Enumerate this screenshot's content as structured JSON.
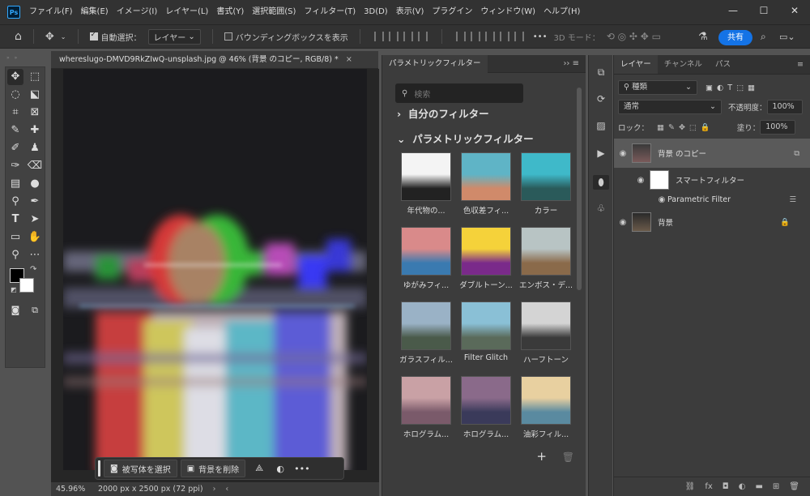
{
  "menubar": {
    "logo": "Ps",
    "items": [
      "ファイル(F)",
      "編集(E)",
      "イメージ(I)",
      "レイヤー(L)",
      "書式(Y)",
      "選択範囲(S)",
      "フィルター(T)",
      "3D(D)",
      "表示(V)",
      "プラグイン",
      "ウィンドウ(W)",
      "ヘルプ(H)"
    ],
    "minimize": "—",
    "maximize": "☐",
    "close": "✕"
  },
  "options": {
    "auto_select_label": "自動選択：",
    "auto_select_value": "レイヤー",
    "bbox_label": "バウンディングボックスを表示",
    "mode3d": "3D モード：",
    "share": "共有",
    "more": "•••"
  },
  "document": {
    "tab_title": "whereslugo-DMVD9RkZIwQ-unsplash.jpg @ 46% (背景 のコピー, RGB/8) *",
    "close": "×",
    "zoom": "45.96%",
    "size": "2000 px x 2500 px (72 ppi)"
  },
  "context_bar": {
    "select_subject": "被写体を選択",
    "remove_bg": "背景を削除",
    "more": "•••"
  },
  "filter_panel": {
    "tab": "パラメトリックフィルター",
    "search_placeholder": "検索",
    "my_filters": "自分のフィルター",
    "param_filters": "パラメトリックフィルター",
    "items": [
      {
        "label": "年代物の...",
        "colors": [
          "#f4f4f4",
          "#222222"
        ]
      },
      {
        "label": "色収差フィ...",
        "colors": [
          "#5fb4c6",
          "#d08a6a"
        ]
      },
      {
        "label": "カラー",
        "colors": [
          "#3fb9c9",
          "#2a5a5a"
        ]
      },
      {
        "label": "ゆがみフィ...",
        "colors": [
          "#d98a8a",
          "#3a7ab0"
        ]
      },
      {
        "label": "ダブルトーン...",
        "colors": [
          "#f5d23a",
          "#7a2a8a"
        ]
      },
      {
        "label": "エンボス・デ...",
        "colors": [
          "#b8c4c4",
          "#8a6a4a"
        ]
      },
      {
        "label": "ガラスフィル...",
        "colors": [
          "#9ab2c6",
          "#4a5a4a"
        ]
      },
      {
        "label": "Filter Glitch",
        "colors": [
          "#8ac0d6",
          "#5a6a5a"
        ]
      },
      {
        "label": "ハーフトーン",
        "colors": [
          "#d4d4d4",
          "#3a3a3a"
        ]
      },
      {
        "label": "ホログラム...",
        "colors": [
          "#c9a1a5",
          "#7a5a6a"
        ]
      },
      {
        "label": "ホログラム...",
        "colors": [
          "#8a6a8a",
          "#3a3a5a"
        ]
      },
      {
        "label": "油彩フィル...",
        "colors": [
          "#e8d0a0",
          "#5a8aa0"
        ]
      }
    ],
    "add": "+",
    "delete": "🗑"
  },
  "layers_panel": {
    "tabs": [
      "レイヤー",
      "チャンネル",
      "パス"
    ],
    "kind_label": "種類",
    "blend_mode": "通常",
    "opacity_label": "不透明度：",
    "opacity_value": "100%",
    "lock_label": "ロック：",
    "fill_label": "塗り：",
    "fill_value": "100%",
    "layers": [
      {
        "name": "背景 のコピー"
      },
      {
        "name": "スマートフィルター"
      },
      {
        "name": "Parametric Filter"
      },
      {
        "name": "背景"
      }
    ]
  },
  "colors": {
    "accent": "#1473e6",
    "bg": "#535353",
    "panel": "#3c3c3c"
  }
}
